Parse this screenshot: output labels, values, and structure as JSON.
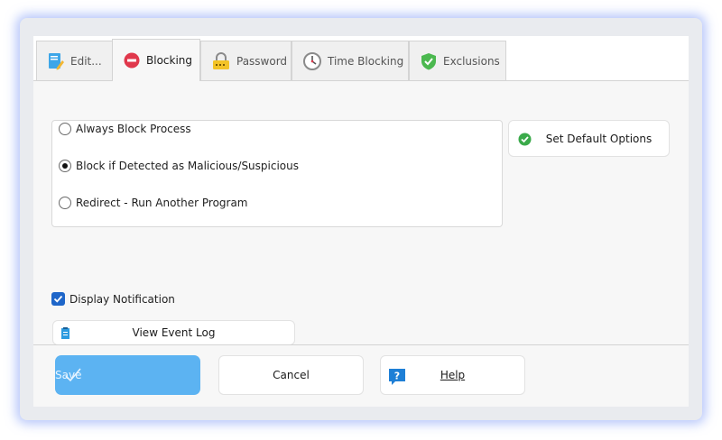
{
  "tabs": [
    {
      "label": "Edit...",
      "icon": "edit-icon"
    },
    {
      "label": "Blocking",
      "icon": "block-icon"
    },
    {
      "label": "Password",
      "icon": "lock-icon"
    },
    {
      "label": "Time Blocking",
      "icon": "clock-icon"
    },
    {
      "label": "Exclusions",
      "icon": "shield-check-icon"
    }
  ],
  "active_tab": "Blocking",
  "block_options": {
    "items": [
      {
        "label": "Always Block Process",
        "selected": false
      },
      {
        "label": "Block if Detected as Malicious/Suspicious",
        "selected": true
      },
      {
        "label": "Redirect - Run Another Program",
        "selected": false
      }
    ]
  },
  "set_default": {
    "label": "Set Default Options",
    "icon": "green-check-icon"
  },
  "notification": {
    "label": "Display Notification",
    "checked": true
  },
  "event_log": {
    "label": "View Event Log",
    "icon": "log-icon"
  },
  "footer": {
    "save": "Save",
    "cancel": "Cancel",
    "help": "Help",
    "help_icon": "help-question-icon"
  },
  "colors": {
    "accent": "#1e66c9",
    "save_bg": "#5cb3f2",
    "glow": "#7896f5",
    "ok_green": "#3aaa4a",
    "block_red": "#e0384c"
  }
}
